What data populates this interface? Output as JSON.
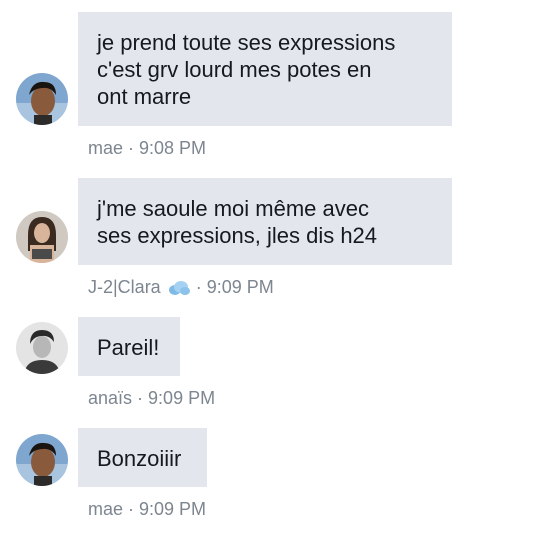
{
  "messages": [
    {
      "author": "mae",
      "text": "je prend toute ses expressions\nc'est grv lourd mes potes en\nont marre",
      "time": "9:08 PM",
      "avatar": "person-avatar"
    },
    {
      "author": "J-2|Clara",
      "text": "j'me saoule moi même avec\nses expressions, jles dis h24",
      "time": "9:09 PM",
      "avatar": "person-avatar",
      "badge_icon": "cloud-icon"
    },
    {
      "author": "anaïs",
      "text": "Pareil!",
      "time": "9:09 PM",
      "avatar": "person-avatar-grayscale"
    },
    {
      "author": "mae",
      "text": "Bonzoiiir",
      "time": "9:09 PM",
      "avatar": "person-avatar"
    }
  ],
  "meta_separator": "·",
  "colors": {
    "bubble_bg": "#e3e7ed",
    "meta_text": "#7d8690",
    "message_text": "#161a1f"
  }
}
